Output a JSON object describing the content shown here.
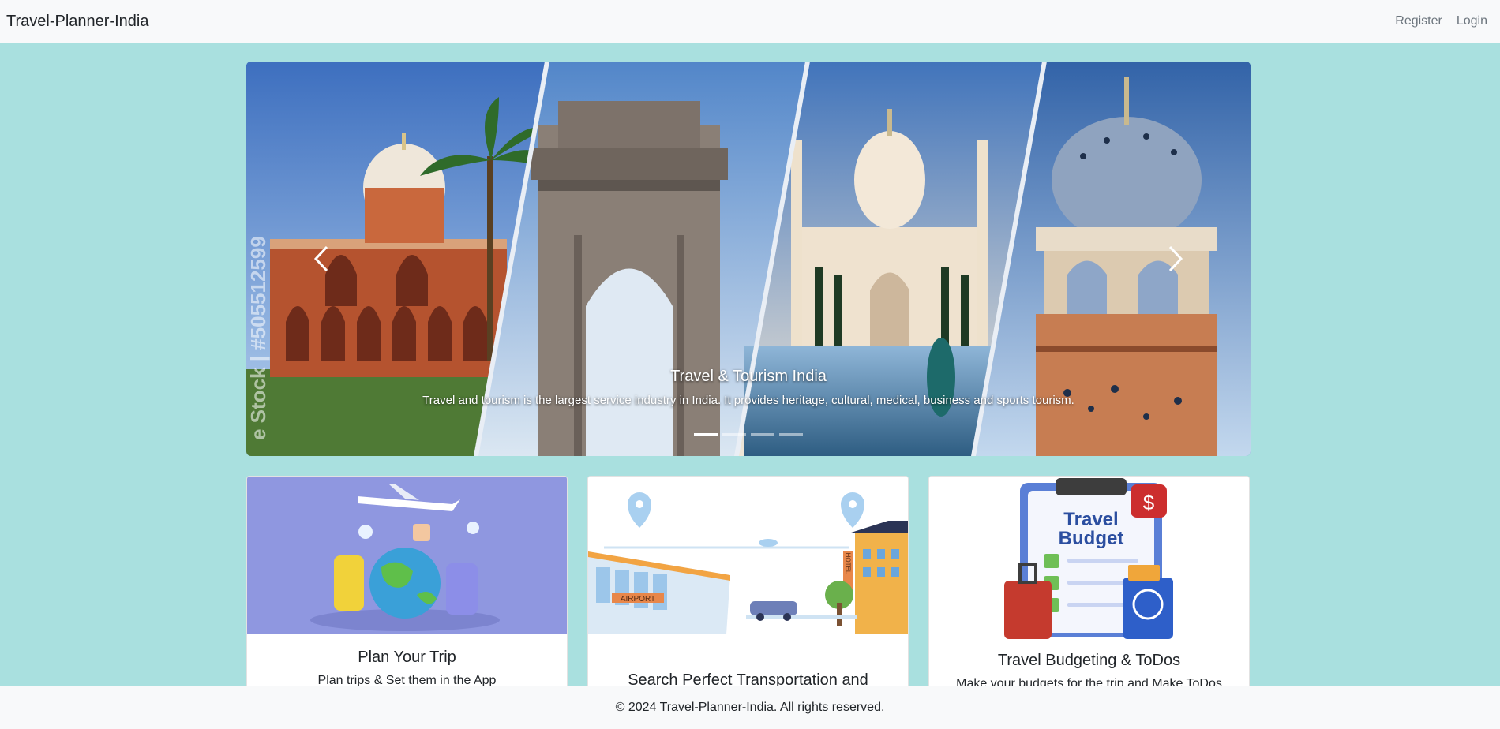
{
  "navbar": {
    "brand": "Travel-Planner-India",
    "links": [
      {
        "label": "Register"
      },
      {
        "label": "Login"
      }
    ]
  },
  "carousel": {
    "caption_title": "Travel & Tourism India",
    "caption_text": "Travel and tourism is the largest service industry in India. It provides heritage, cultural, medical, business and sports tourism.",
    "watermark": "e Stock | #505512599",
    "indicator_count": 4,
    "active_indicator": 1,
    "prev_icon": "chevron-left-icon",
    "next_icon": "chevron-right-icon"
  },
  "cards": [
    {
      "title": "Plan Your Trip",
      "text": "Plan trips & Set them in the App"
    },
    {
      "title": "Search Perfect Transportation and",
      "text": ""
    },
    {
      "title": "Travel Budgeting & ToDos",
      "text": "Make your budgets for the trip and Make ToDos"
    }
  ],
  "card_art": {
    "budget_title_line1": "Travel",
    "budget_title_line2": "Budget",
    "airport_sign": "AIRPORT",
    "hotel_sign": "HOTEL"
  },
  "footer": {
    "text": "© 2024 Travel-Planner-India. All rights reserved."
  },
  "colors": {
    "page_bg": "#a9e0df",
    "navbar_bg": "#f8f9fa",
    "footer_bg": "#f8f9fa"
  }
}
